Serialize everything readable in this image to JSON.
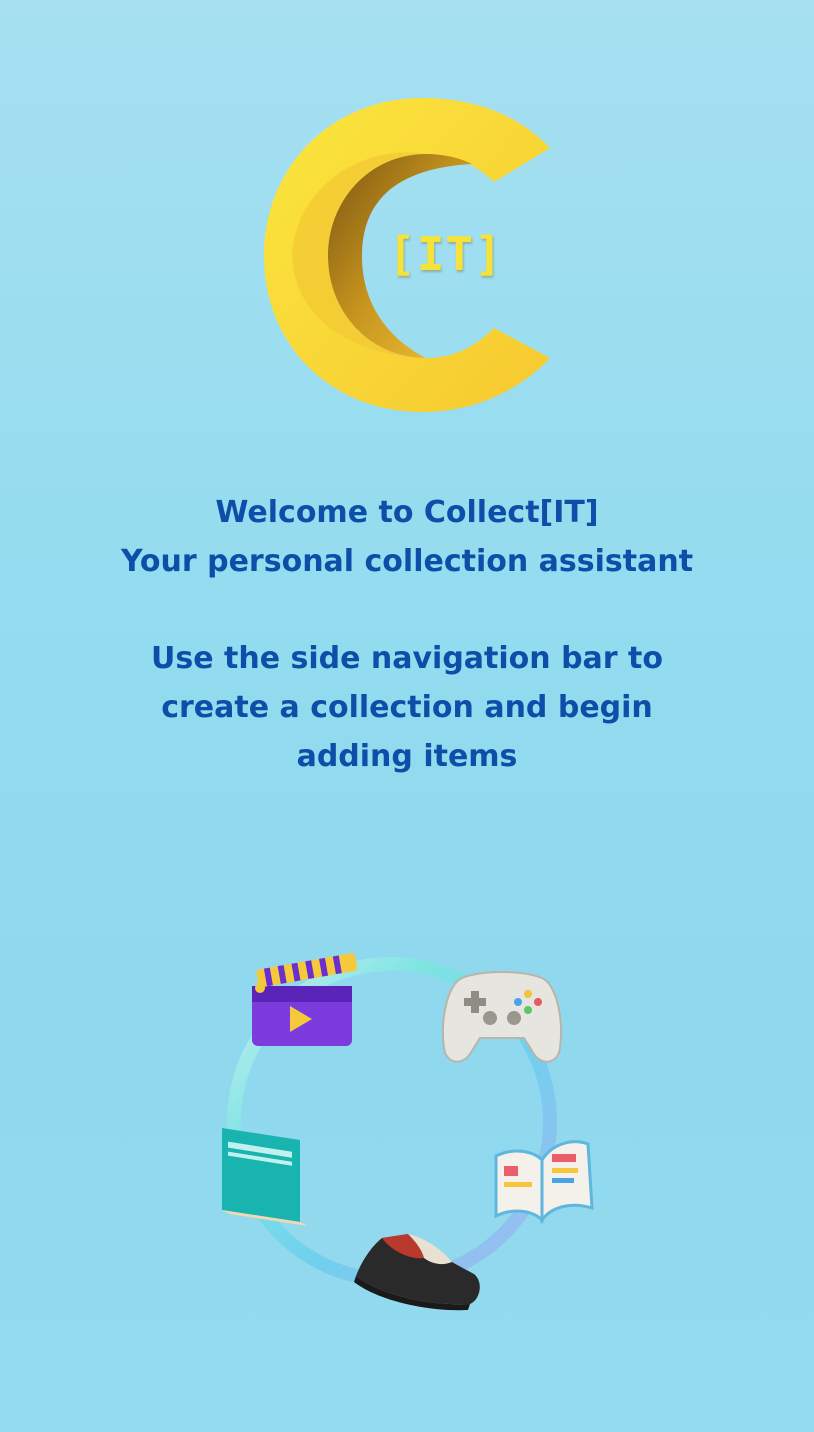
{
  "logo": {
    "letter": "C",
    "brand_suffix": "[IT]",
    "colors": {
      "primary": "#f9dc3a",
      "shadow": "#b98a1a",
      "accent": "#f5e23a"
    }
  },
  "welcome": {
    "line1": "Welcome to Collect[IT]",
    "line2": "Your personal collection assistant"
  },
  "instructions": {
    "line1": "Use the side navigation bar to",
    "line2": "create a collection and begin",
    "line3": "adding items"
  },
  "illustration": {
    "items": [
      "clapperboard-icon",
      "game-controller-icon",
      "open-book-icon",
      "sneaker-icon",
      "closed-book-icon"
    ]
  },
  "colors": {
    "text": "#0d4fa8",
    "background": "#94dcef"
  }
}
